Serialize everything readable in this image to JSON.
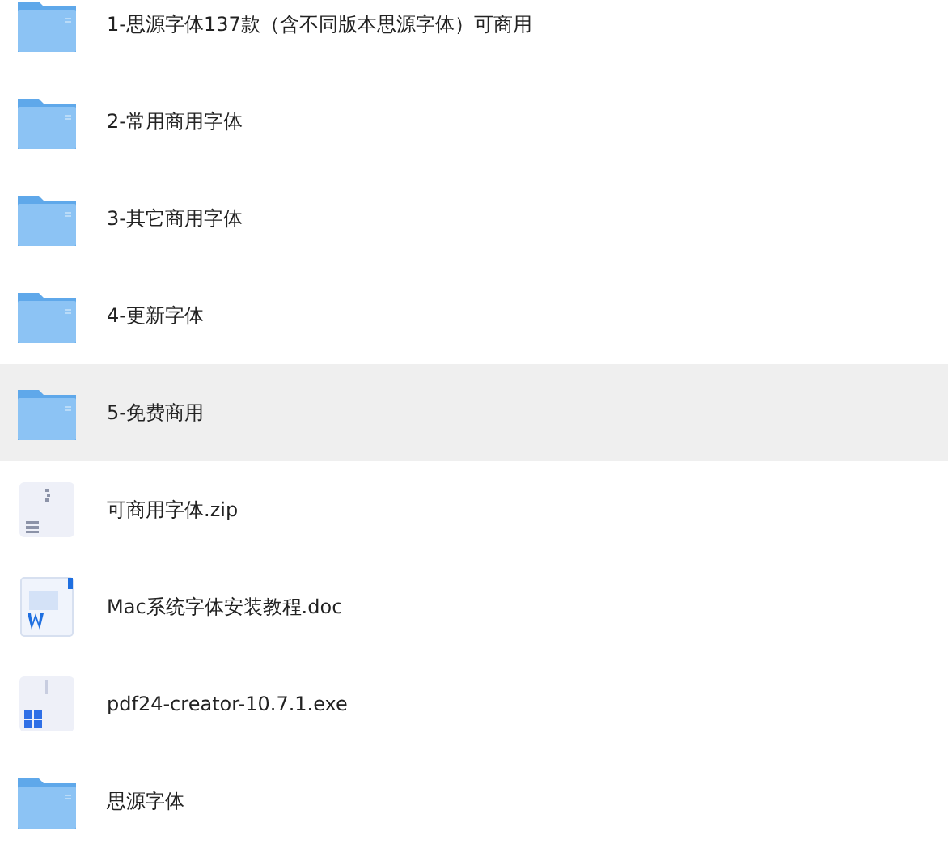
{
  "files": [
    {
      "name": "1-思源字体137款（含不同版本思源字体）可商用",
      "kind": "folder",
      "selected": false
    },
    {
      "name": "2-常用商用字体",
      "kind": "folder",
      "selected": false
    },
    {
      "name": "3-其它商用字体",
      "kind": "folder",
      "selected": false
    },
    {
      "name": "4-更新字体",
      "kind": "folder",
      "selected": false
    },
    {
      "name": "5-免费商用",
      "kind": "folder",
      "selected": true
    },
    {
      "name": "可商用字体.zip",
      "kind": "zip",
      "selected": false
    },
    {
      "name": "Mac系统字体安装教程.doc",
      "kind": "doc",
      "selected": false
    },
    {
      "name": "pdf24-creator-10.7.1.exe",
      "kind": "exe",
      "selected": false
    },
    {
      "name": "思源字体",
      "kind": "folder",
      "selected": false
    }
  ]
}
